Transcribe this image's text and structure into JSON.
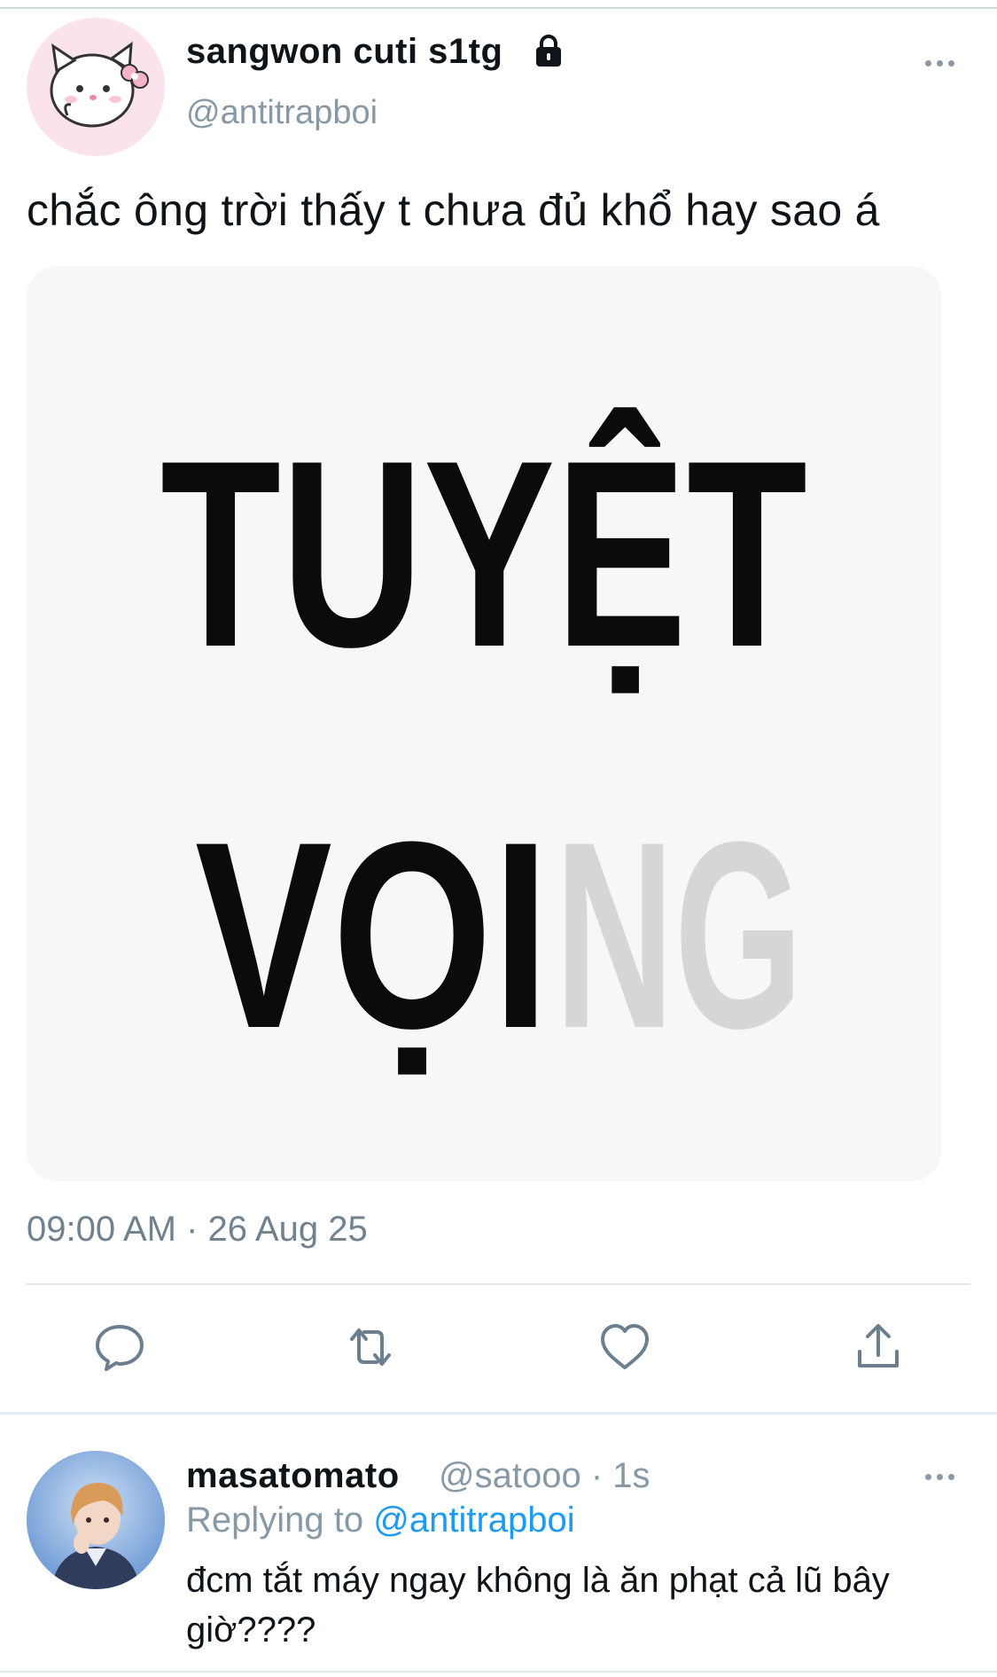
{
  "tweet": {
    "display_name": "sangwon cuti s1tg",
    "handle": "@antitrapboi",
    "text": "chắc ông trời thấy t chưa đủ khổ hay sao á",
    "media_text": {
      "line1": "TUYỆT",
      "line2_dark": "VỌI",
      "line2_faded": "NG"
    },
    "timestamp": "09:00 AM · 26 Aug 25"
  },
  "reply": {
    "display_name": "masatomato",
    "meta": "@satooo · 1s",
    "replying_prefix": "Replying to ",
    "replying_mention": "@antitrapboi",
    "text": "đcm tắt máy ngay không là ăn phạt cả lũ bây giờ????"
  },
  "icons": {
    "lock": "lock-icon",
    "more": "more-dots-icon",
    "reply": "reply-bubble-icon",
    "retweet": "retweet-icon",
    "like": "heart-icon",
    "share": "share-upload-icon"
  },
  "colors": {
    "text": "#0f1419",
    "secondary": "#8899a6",
    "link": "#1d9bf0",
    "icon": "#6b7f8e",
    "media_bg": "#f7f7f5"
  }
}
